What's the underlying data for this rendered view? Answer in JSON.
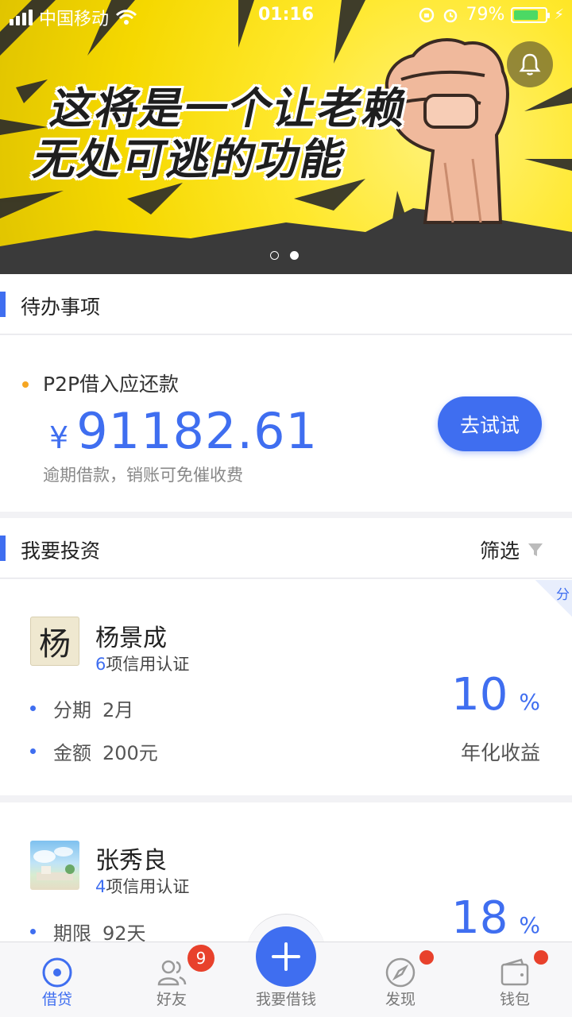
{
  "status_bar": {
    "carrier": "中国移动",
    "time": "01:16",
    "battery": "79%"
  },
  "banner": {
    "line1": "这将是一个让老赖",
    "line2": "无处可逃的功能",
    "page_count": 2,
    "active_page": 2
  },
  "todo": {
    "title": "待办事项",
    "item_label": "P2P借入应还款",
    "currency": "¥",
    "amount": "91182.61",
    "note": "逾期借款，销账可免催收费",
    "button": "去试试"
  },
  "invest": {
    "title": "我要投资",
    "filter": "筛选",
    "corner_tag": "分",
    "items": [
      {
        "avatar_char": "杨",
        "name": "杨景成",
        "credit_count": "6",
        "credit_suffix": "项信用认证",
        "row1_key": "分期",
        "row1_val": "2月",
        "row2_key": "金额",
        "row2_val": "200元",
        "rate": "10",
        "rate_unit": "%",
        "rate_label": "年化收益"
      },
      {
        "name": "张秀良",
        "credit_count": "4",
        "credit_suffix": "项信用认证",
        "row1_key": "期限",
        "row1_val": "92天",
        "rate": "18",
        "rate_unit": "%"
      }
    ]
  },
  "tabbar": {
    "tabs": [
      {
        "label": "借贷",
        "icon": "loan-icon",
        "active": true
      },
      {
        "label": "好友",
        "icon": "friends-icon",
        "badge": "9"
      },
      {
        "label": "我要借钱",
        "icon": "plus-icon"
      },
      {
        "label": "发现",
        "icon": "compass-icon",
        "dot": true
      },
      {
        "label": "钱包",
        "icon": "wallet-icon",
        "dot": true
      }
    ]
  },
  "colors": {
    "accent": "#3f6ef0",
    "badge": "#e8412c",
    "banner_yellow": "#ffe82c"
  }
}
